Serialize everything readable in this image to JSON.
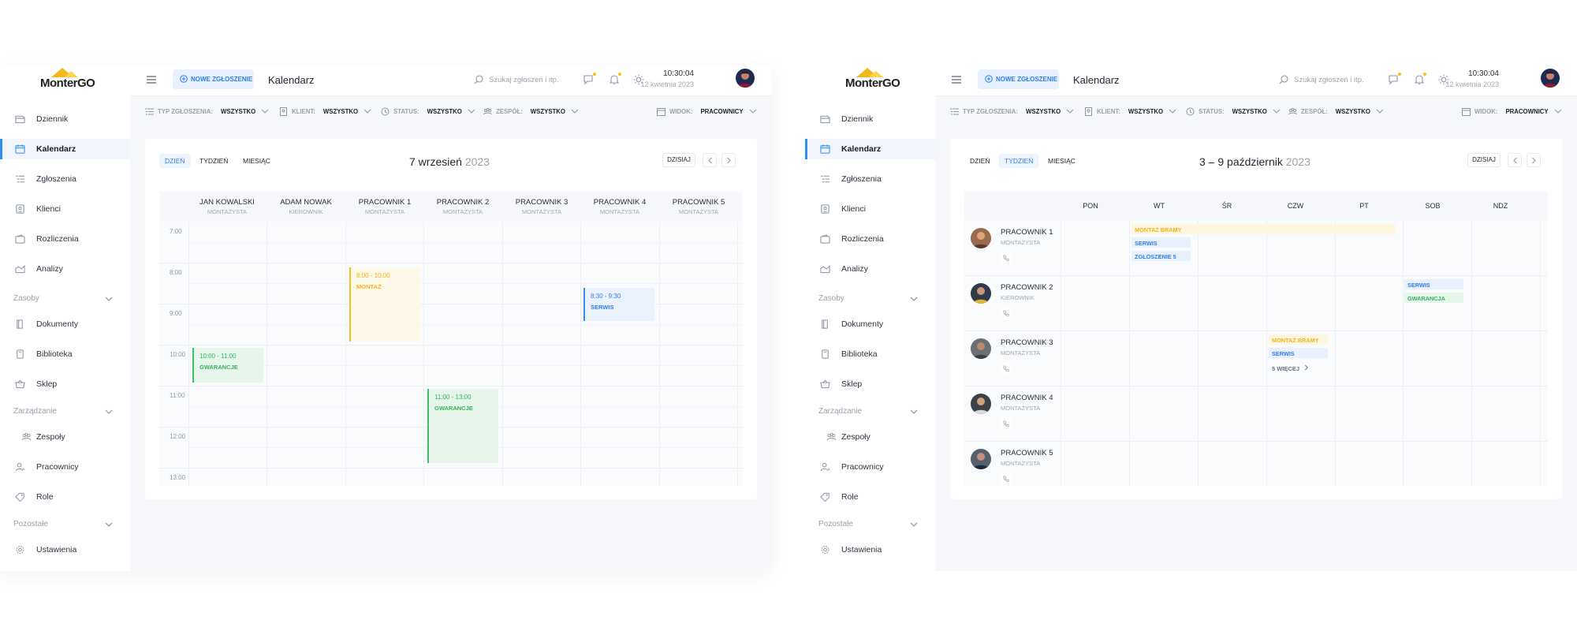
{
  "brand": {
    "logo_text": "MonterGO"
  },
  "sidebar": {
    "items": [
      {
        "label": "Dziennik"
      },
      {
        "label": "Kalendarz"
      },
      {
        "label": "Zgłoszenia"
      },
      {
        "label": "Klienci"
      },
      {
        "label": "Rozliczenia"
      },
      {
        "label": "Analizy"
      },
      {
        "label": "Dokumenty"
      },
      {
        "label": "Biblioteka"
      },
      {
        "label": "Sklep"
      },
      {
        "label": "Zespoły"
      },
      {
        "label": "Pracownicy"
      },
      {
        "label": "Role"
      },
      {
        "label": "Ustawienia"
      }
    ],
    "sections": [
      {
        "label": "Zasoby"
      },
      {
        "label": "Zarządzanie"
      },
      {
        "label": "Pozostałe"
      }
    ]
  },
  "topbar": {
    "new_button": "NOWE ZGŁOSZENIE",
    "title": "Kalendarz",
    "search_placeholder": "Szukaj zgłoszeń i itp.",
    "time": "10:30:04",
    "date": "12 kwietnia 2023"
  },
  "filters": {
    "type": {
      "label": "TYP ZGŁOSZENIA:",
      "value": "WSZYSTKO"
    },
    "client": {
      "label": "KLIENT:",
      "value": "WSZYSTKO"
    },
    "status": {
      "label": "STATUS:",
      "value": "WSZYSTKO"
    },
    "team": {
      "label": "ZESPÓŁ:",
      "value": "WSZYSTKO"
    },
    "view": {
      "label": "WIDOK:",
      "value": "PRACOWNICY"
    }
  },
  "view_tabs": {
    "day": "DZIEŃ",
    "week": "TYDZIEŃ",
    "month": "MIESIĄC"
  },
  "today_button": "DZISIAJ",
  "day_view": {
    "date_main": "7 wrzesień",
    "date_year": "2023",
    "columns": [
      {
        "name": "JAN KOWALSKI",
        "role": "MONTAŻYSTA"
      },
      {
        "name": "ADAM NOWAK",
        "role": "KIEROWNIK"
      },
      {
        "name": "PRACOWNIK 1",
        "role": "MONTAŻYSTA"
      },
      {
        "name": "PRACOWNIK 2",
        "role": "MONTAŻYSTA"
      },
      {
        "name": "PRACOWNIK 3",
        "role": "MONTAŻYSTA"
      },
      {
        "name": "PRACOWNIK 4",
        "role": "MONTAŻYSTA"
      },
      {
        "name": "PRACOWNIK 5",
        "role": "MONTAŻYSTA"
      }
    ],
    "times": [
      "7:00",
      "8:00",
      "9:00",
      "10:00",
      "11:00",
      "12:00",
      "13:00"
    ],
    "events": [
      {
        "time": "8:00 - 10:00",
        "title": "MONTAŻ",
        "color": "#f4c21f"
      },
      {
        "time": "8:30 - 9:30",
        "title": "SERWIS",
        "color": "#3d8bec"
      },
      {
        "time": "10:00 - 11:00",
        "title": "GWARANCJE",
        "color": "#3fbf6a"
      },
      {
        "time": "11:00 - 13:00",
        "title": "GWARANCJE",
        "color": "#3fbf6a"
      }
    ]
  },
  "week_view": {
    "date_main": "3 – 9 październik",
    "date_year": "2023",
    "days": [
      "PON",
      "WT",
      "ŚR",
      "CZW",
      "PT",
      "SOB",
      "NDZ"
    ],
    "workers": [
      {
        "name": "PRACOWNIK 1",
        "role": "MONTAŻYSTA"
      },
      {
        "name": "PRACOWNIK 2",
        "role": "KIEROWNIK"
      },
      {
        "name": "PRACOWNIK 3",
        "role": "MONTAŻYSTA"
      },
      {
        "name": "PRACOWNIK 4",
        "role": "MONTAŻYSTA"
      },
      {
        "name": "PRACOWNIK 5",
        "role": "MONTAŻYSTA"
      }
    ],
    "chips": {
      "montaz_bramy_1": "MONTAŻ BRAMY",
      "serwis_1": "SERWIS",
      "zgloszenie_5": "ZGŁOSZENIE 5",
      "serwis_2": "SERWIS",
      "gwarancja": "GWARANCJA",
      "montaz_bramy_3": "MONTAŻ BRAMY",
      "serwis_3": "SERWIS"
    },
    "more_link": "5 WIĘCEJ"
  },
  "colors": {
    "accent": "#2f8ff2",
    "yellow": "#f4c21f",
    "blue": "#3d8bec",
    "green": "#3fbf6a",
    "brand": "#f5b81b"
  },
  "icons": [
    "menu-icon",
    "plus-circle-icon",
    "search-icon",
    "chat-icon",
    "bell-icon",
    "sun-icon",
    "chevron-down-icon",
    "chevron-left-icon",
    "chevron-right-icon",
    "phone-icon",
    "filter-icon",
    "calendar-icon"
  ]
}
